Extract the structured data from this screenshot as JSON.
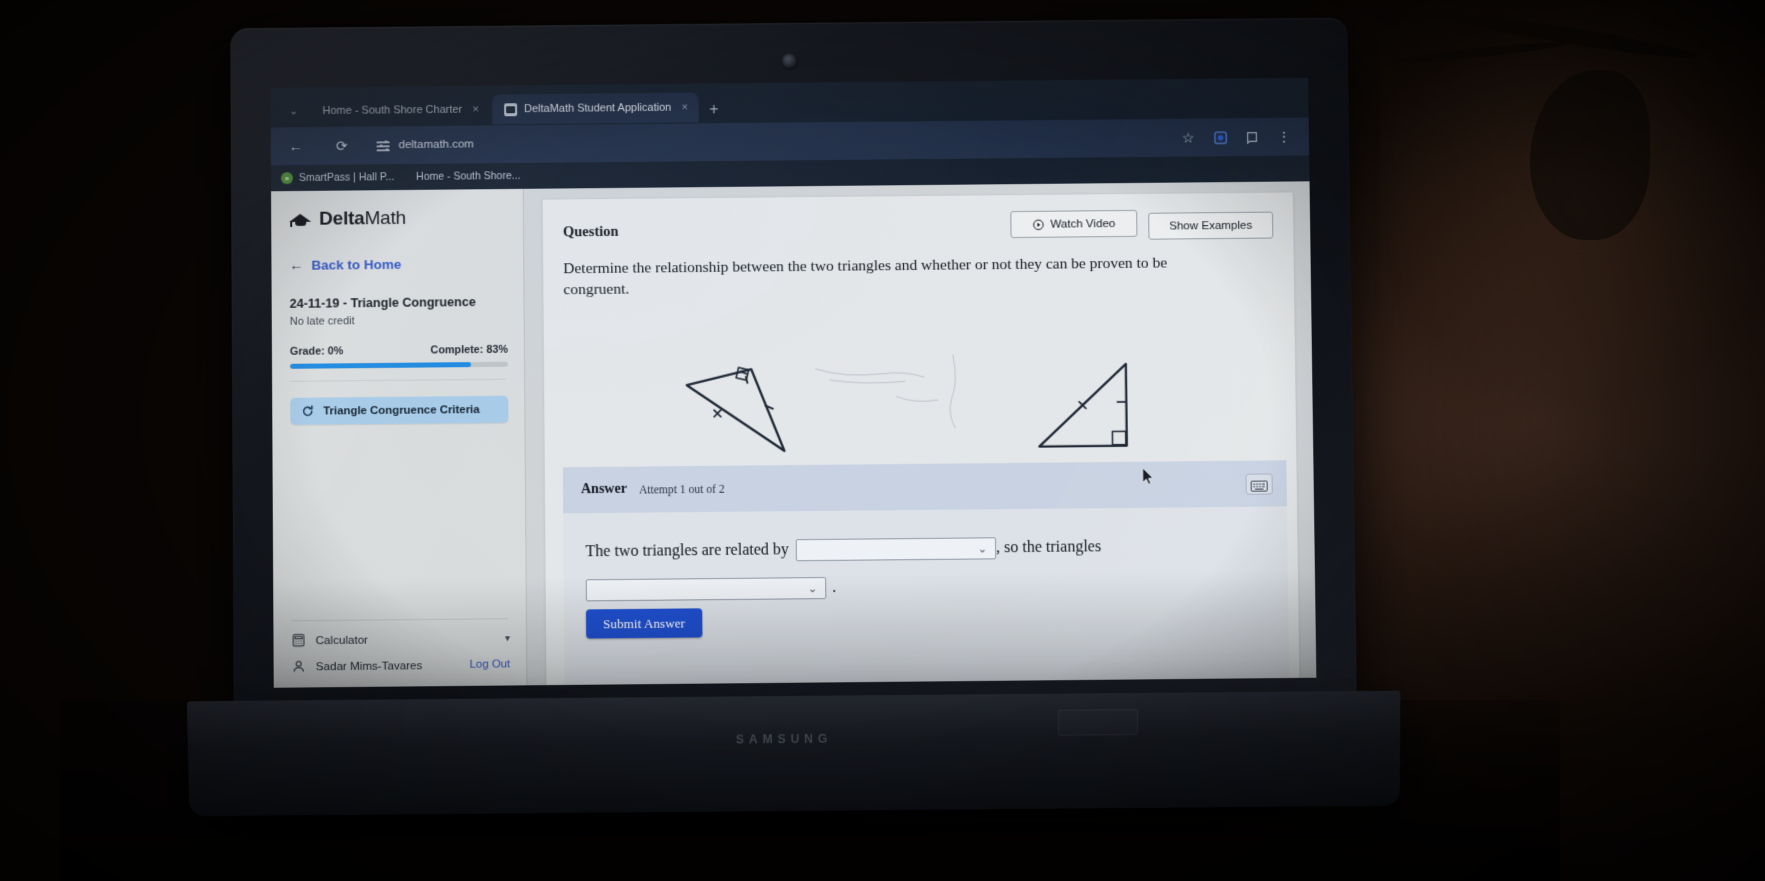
{
  "browser": {
    "tabs": [
      {
        "title": "Home - South Shore Charter",
        "close": "×",
        "active": false,
        "favicon": "page-icon"
      },
      {
        "title": "DeltaMath Student Application",
        "close": "×",
        "active": true,
        "favicon": "deltamath-icon"
      }
    ],
    "new_tab_label": "+",
    "tabstrip_chevron": "⌄",
    "back_icon": "←",
    "reload_icon": "⟳",
    "url": "deltamath.com",
    "star_icon": "☆",
    "menu_icon": "⋮",
    "bookmarks": [
      {
        "label": "SmartPass | Hall P...",
        "badge": "»"
      },
      {
        "label": "Home - South Shore..."
      }
    ]
  },
  "sidebar": {
    "logo": "Delta",
    "logo_light": "Math",
    "back_to_home": "Back to Home",
    "assignment_title": "24-11-19 - Triangle Congruence",
    "assignment_subtitle": "No late credit",
    "grade_label": "Grade: 0%",
    "complete_label": "Complete: 83%",
    "progress_percent": 83,
    "skills": [
      {
        "label": "Triangle Congruence Criteria",
        "icon": "redo-icon",
        "selected": true
      }
    ],
    "calculator_label": "Calculator",
    "user_name": "Sadar Mims-Tavares",
    "log_out_label": "Log Out"
  },
  "question": {
    "header_label": "Question",
    "watch_video_label": "Watch Video",
    "show_examples_label": "Show Examples",
    "prompt": "Determine the relationship between the two triangles and whether or not they can be proven to be congruent."
  },
  "answer": {
    "label": "Answer",
    "attempt": "Attempt 1 out of 2",
    "sentence_start": "The two triangles are related by",
    "sentence_middle": ", so the triangles",
    "sentence_end": ".",
    "dropdown_1_value": "",
    "dropdown_2_value": "",
    "dropdown_caret": "⌄",
    "submit_label": "Submit Answer"
  },
  "laptop": {
    "screen_brand": "",
    "base_brand": "SAMSUNG"
  },
  "colors": {
    "accent_blue": "#1e4fd0",
    "progress_blue": "#1f8ae0",
    "link_blue": "#2f55c4",
    "skill_highlight": "#a7cbe8"
  }
}
